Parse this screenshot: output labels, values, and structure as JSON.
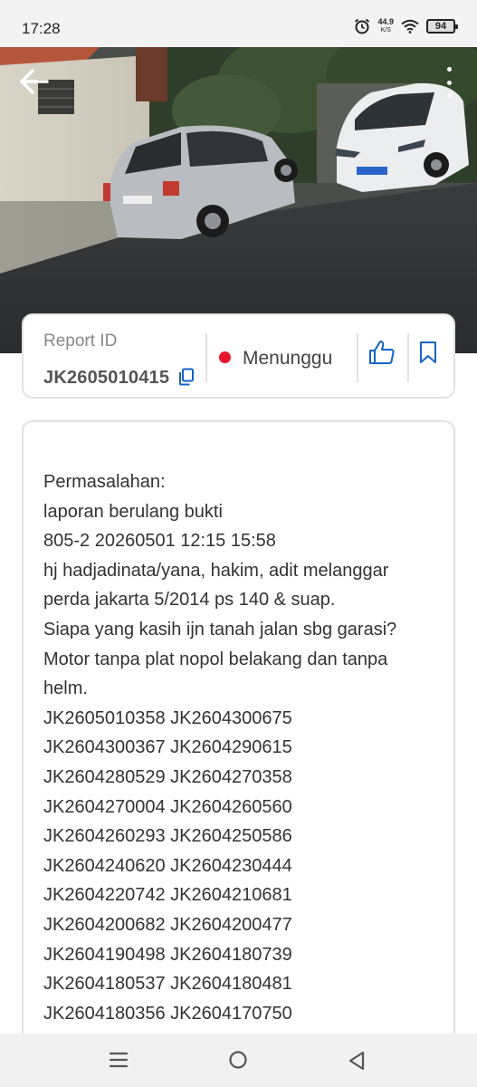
{
  "status_bar": {
    "time": "17:28",
    "speed_value": "44.9",
    "speed_unit": "K/S",
    "battery": "94",
    "icons": [
      "alarm-icon",
      "wifi-icon",
      "battery-icon"
    ]
  },
  "header": {
    "back_icon": "arrow-left-icon",
    "menu_icon": "more-vertical-icon"
  },
  "report": {
    "label": "Report ID",
    "id": "JK2605010415",
    "copy_icon": "copy-icon",
    "status": "Menunggu",
    "status_color": "#e8132c",
    "like_icon": "thumbs-up-icon",
    "bookmark_icon": "bookmark-icon"
  },
  "description": {
    "lines": [
      "Permasalahan:",
      "laporan berulang bukti",
      "805-2 20260501 12:15 15:58",
      "hj hadjadinata/yana, hakim, adit melanggar",
      "perda jakarta 5/2014 ps 140 & suap.",
      "Siapa yang kasih ijn tanah jalan sbg garasi?",
      "Motor tanpa plat nopol belakang dan tanpa",
      "helm.",
      "JK2605010358 JK2604300675",
      "JK2604300367 JK2604290615",
      "JK2604280529 JK2604270358",
      "JK2604270004 JK2604260560",
      "JK2604260293 JK2604250586",
      "JK2604240620 JK2604230444",
      "JK2604220742 JK2604210681",
      "JK2604200682 JK2604200477",
      "JK2604190498 JK2604180739",
      "JK2604180537 JK2604180481",
      "JK2604180356 JK2604170750"
    ]
  },
  "nav": {
    "icons": [
      "menu-icon",
      "home-icon",
      "back-icon"
    ]
  },
  "colors": {
    "accent": "#1565c0",
    "border": "#e2e2e2",
    "status_red": "#e8132c"
  }
}
